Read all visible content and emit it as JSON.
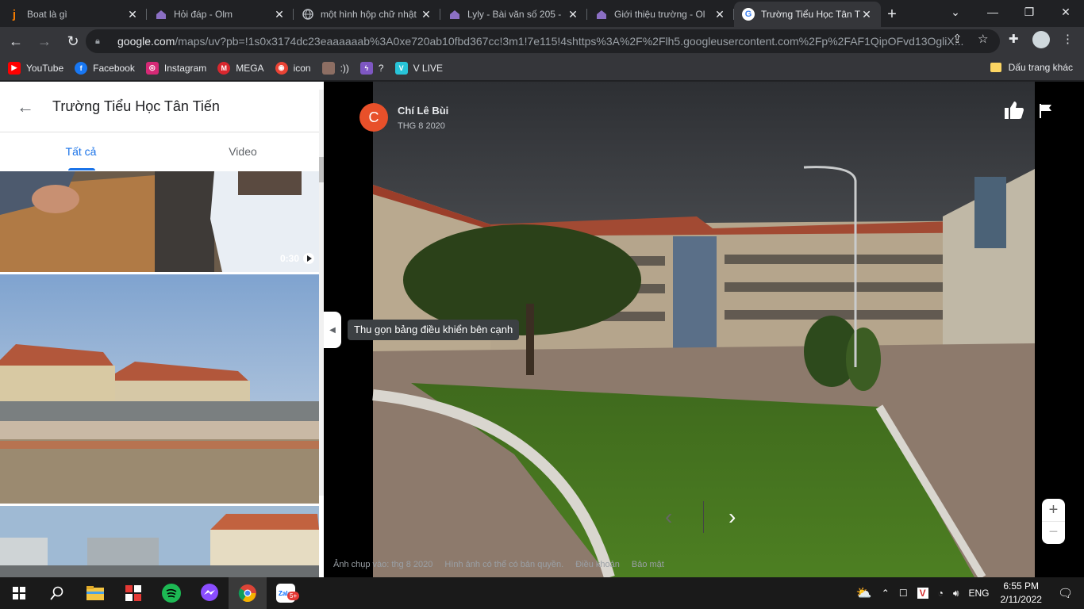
{
  "browser": {
    "tabs": [
      {
        "title": "Boat là gì",
        "favicon": "j",
        "favicon_color": "#f57c00"
      },
      {
        "title": "Hỏi đáp - Olm",
        "favicon": "olm-icon",
        "favicon_color": "#7b5ea7"
      },
      {
        "title": "một hình hộp chữ nhật",
        "favicon": "globe-icon",
        "favicon_color": "#9aa0a6"
      },
      {
        "title": "Lyly - Bài văn số 205 -",
        "favicon": "olm-icon",
        "favicon_color": "#7b5ea7"
      },
      {
        "title": "Giới thiệu trường - Ol",
        "favicon": "olm-icon",
        "favicon_color": "#7b5ea7"
      },
      {
        "title": "Trường Tiểu Học Tân T",
        "favicon": "G",
        "favicon_color": "#4285f4",
        "active": true
      }
    ],
    "url_host": "google.com",
    "url_path": "/maps/uv?pb=!1s0x3174dc23eaaaaaab%3A0xe720ab10fbd367cc!3m1!7e115!4shttps%3A%2F%2Flh5.googleusercontent.com%2Fp%2FAF1QipOFvd13OgliX...",
    "bookmarks": [
      {
        "label": "YouTube",
        "icon": "youtube-icon",
        "color": "#ff0000"
      },
      {
        "label": "Facebook",
        "icon": "facebook-icon",
        "color": "#1877f2"
      },
      {
        "label": "Instagram",
        "icon": "instagram-icon",
        "color": "#d62976"
      },
      {
        "label": "MEGA",
        "icon": "mega-icon",
        "color": "#d9272e"
      },
      {
        "label": "icon",
        "icon": "search-icon",
        "color": "#ea4335"
      },
      {
        "label": ":))",
        "icon": "avatar-icon",
        "color": "#8d6e63"
      },
      {
        "label": "?",
        "icon": "bolt-icon",
        "color": "#7e57c2"
      },
      {
        "label": "V LIVE",
        "icon": "vlive-icon",
        "color": "#28c4d8"
      }
    ],
    "other_bookmarks": "Dấu trang khác"
  },
  "panel": {
    "title": "Trường Tiểu Học Tân Tiến",
    "tab_all": "Tất cả",
    "tab_video": "Video",
    "video_duration": "0:30"
  },
  "viewer": {
    "author_initial": "C",
    "author_name": "Chí Lê Bùi",
    "photo_date": "THG 8 2020",
    "tooltip": "Thu gọn bảng điều khiển bên cạnh",
    "footer": {
      "captured": "Ảnh chụp vào: thg 8 2020",
      "copyright": "Hình ảnh có thể có bản quyền.",
      "terms": "Điều khoản",
      "privacy": "Bảo mật"
    }
  },
  "taskbar": {
    "language": "ENG",
    "time": "6:55 PM",
    "date": "2/11/2022",
    "zalo_badge": "5+"
  }
}
